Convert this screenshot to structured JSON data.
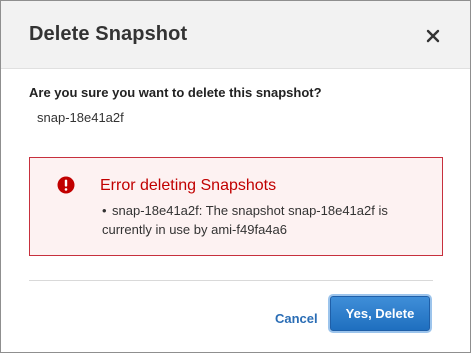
{
  "dialog": {
    "title": "Delete Snapshot",
    "close_icon": "close-icon",
    "question": "Are you sure you want to delete this snapshot?",
    "snapshot_id": "snap-18e41a2f"
  },
  "error": {
    "icon": "error-icon",
    "title": "Error deleting Snapshots",
    "bullet": "•",
    "message_line1": "snap-18e41a2f: The snapshot snap-18e41a2f is",
    "message_line2": "currently in use by ami-f49fa4a6"
  },
  "footer": {
    "cancel_label": "Cancel",
    "delete_label": "Yes, Delete"
  },
  "colors": {
    "error_red": "#c10000",
    "error_border": "#c7303d",
    "link_blue": "#2a6db5",
    "primary_button": "#1f6fbf"
  }
}
